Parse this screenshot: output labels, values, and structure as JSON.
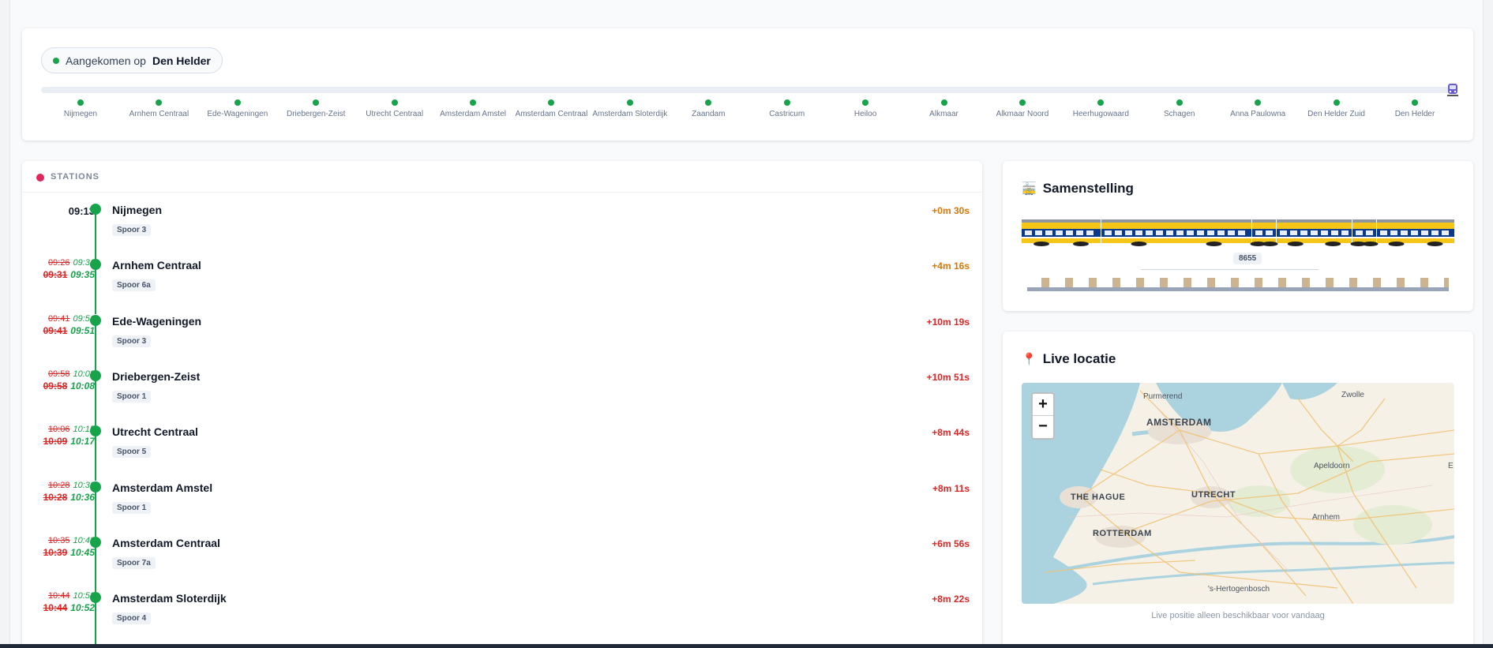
{
  "progress": {
    "arrived_label": "Aangekomen op",
    "arrived_station": "Den Helder",
    "stops": [
      "Nijmegen",
      "Arnhem Centraal",
      "Ede-Wageningen",
      "Driebergen-Zeist",
      "Utrecht Centraal",
      "Amsterdam Amstel",
      "Amsterdam Centraal",
      "Amsterdam Sloterdijk",
      "Zaandam",
      "Castricum",
      "Heiloo",
      "Alkmaar",
      "Alkmaar Noord",
      "Heerhugowaard",
      "Schagen",
      "Anna Paulowna",
      "Den Helder Zuid",
      "Den Helder"
    ],
    "progress_fraction": 1.0
  },
  "stations": {
    "header": "STATIONS",
    "rows": [
      {
        "name": "Nijmegen",
        "platform": "Spoor 3",
        "time": "09:13",
        "delay": "+0m 30s",
        "delay_level": "amber"
      },
      {
        "name": "Arnhem Centraal",
        "platform": "Spoor 6a",
        "arr_sched": "09:26",
        "arr_actual": "09:31",
        "dep_sched": "09:31",
        "dep_actual": "09:35",
        "delay": "+4m 16s",
        "delay_level": "amber"
      },
      {
        "name": "Ede-Wageningen",
        "platform": "Spoor 3",
        "arr_sched": "09:41",
        "arr_actual": "09:51",
        "dep_sched": "09:41",
        "dep_actual": "09:51",
        "delay": "+10m 19s",
        "delay_level": "red"
      },
      {
        "name": "Driebergen-Zeist",
        "platform": "Spoor 1",
        "arr_sched": "09:58",
        "arr_actual": "10:08",
        "dep_sched": "09:58",
        "dep_actual": "10:08",
        "delay": "+10m 51s",
        "delay_level": "red"
      },
      {
        "name": "Utrecht Centraal",
        "platform": "Spoor 5",
        "arr_sched": "10:06",
        "arr_actual": "10:15",
        "dep_sched": "10:09",
        "dep_actual": "10:17",
        "delay": "+8m 44s",
        "delay_level": "red"
      },
      {
        "name": "Amsterdam Amstel",
        "platform": "Spoor 1",
        "arr_sched": "10:28",
        "arr_actual": "10:36",
        "dep_sched": "10:28",
        "dep_actual": "10:36",
        "delay": "+8m 11s",
        "delay_level": "red"
      },
      {
        "name": "Amsterdam Centraal",
        "platform": "Spoor 7a",
        "arr_sched": "10:35",
        "arr_actual": "10:43",
        "dep_sched": "10:39",
        "dep_actual": "10:45",
        "delay": "+6m 56s",
        "delay_level": "red"
      },
      {
        "name": "Amsterdam Sloterdijk",
        "platform": "Spoor 4",
        "arr_sched": "10:44",
        "arr_actual": "10:52",
        "dep_sched": "10:44",
        "dep_actual": "10:52",
        "delay": "+8m 22s",
        "delay_level": "red"
      }
    ]
  },
  "composition": {
    "title": "Samenstelling",
    "icon": "train-icon",
    "stock_number": "8655",
    "colors": {
      "body": "#f5c518",
      "band": "#0a3a8f",
      "roof": "#8e96a0"
    }
  },
  "live": {
    "title": "Live locatie",
    "icon": "pin-icon",
    "zoom_in": "+",
    "zoom_out": "−",
    "note": "Live positie alleen beschikbaar voor vandaag",
    "labels": {
      "purmerend": "Purmerend",
      "zwolle": "Zwolle",
      "amsterdam": "AMSTERDAM",
      "apeldoorn": "Apeldoorn",
      "e": "E",
      "the_hague": "THE HAGUE",
      "utrecht": "UTRECHT",
      "arnhem": "Arnhem",
      "rotterdam": "ROTTERDAM",
      "den_bosch": "'s-Hertogenbosch"
    }
  },
  "colors": {
    "green": "#16a34a",
    "red": "#dc2626",
    "amber": "#d97706",
    "pink": "#e0265c"
  }
}
